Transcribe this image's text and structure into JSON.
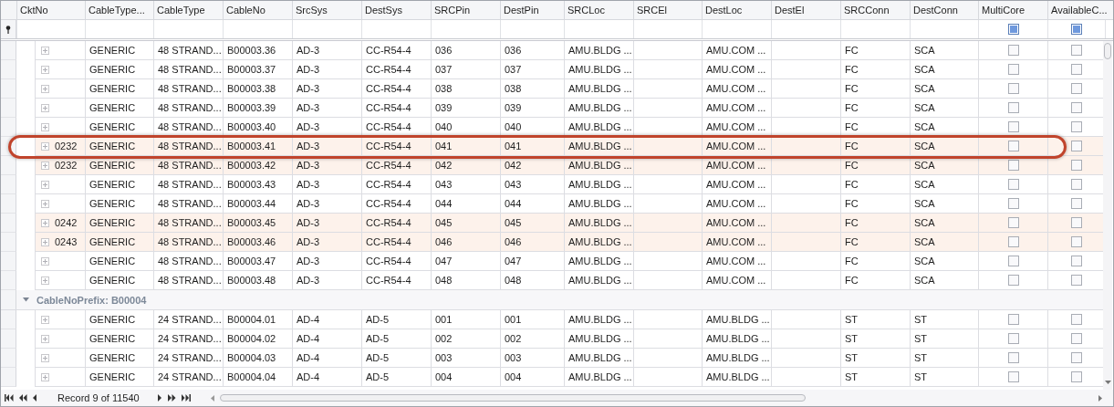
{
  "columns": [
    {
      "label": "CktNo",
      "kind": "text"
    },
    {
      "label": "CableType...",
      "kind": "text"
    },
    {
      "label": "CableType",
      "kind": "text"
    },
    {
      "label": "CableNo",
      "kind": "text"
    },
    {
      "label": "SrcSys",
      "kind": "text"
    },
    {
      "label": "DestSys",
      "kind": "text"
    },
    {
      "label": "SRCPin",
      "kind": "text"
    },
    {
      "label": "DestPin",
      "kind": "text"
    },
    {
      "label": "SRCLoc",
      "kind": "text"
    },
    {
      "label": "SRCEl",
      "kind": "text"
    },
    {
      "label": "DestLoc",
      "kind": "text"
    },
    {
      "label": "DestEl",
      "kind": "text"
    },
    {
      "label": "SRCConn",
      "kind": "text"
    },
    {
      "label": "DestConn",
      "kind": "text"
    },
    {
      "label": "MultiCore",
      "kind": "check",
      "filter_indeterminate": true
    },
    {
      "label": "AvailableC...",
      "kind": "check",
      "filter_indeterminate": true
    }
  ],
  "groups": [
    {
      "rows": [
        {
          "highlighted": false,
          "cells": [
            null,
            "GENERIC",
            "48 STRAND...",
            "B00003.36",
            "AD-3",
            "CC-R54-4",
            "036",
            "036",
            "AMU.BLDG ...",
            null,
            "AMU.COM ...",
            null,
            "FC",
            "SCA",
            false,
            false
          ]
        },
        {
          "highlighted": false,
          "cells": [
            null,
            "GENERIC",
            "48 STRAND...",
            "B00003.37",
            "AD-3",
            "CC-R54-4",
            "037",
            "037",
            "AMU.BLDG ...",
            null,
            "AMU.COM ...",
            null,
            "FC",
            "SCA",
            false,
            false
          ]
        },
        {
          "highlighted": false,
          "cells": [
            null,
            "GENERIC",
            "48 STRAND...",
            "B00003.38",
            "AD-3",
            "CC-R54-4",
            "038",
            "038",
            "AMU.BLDG ...",
            null,
            "AMU.COM ...",
            null,
            "FC",
            "SCA",
            false,
            false
          ]
        },
        {
          "highlighted": false,
          "cells": [
            null,
            "GENERIC",
            "48 STRAND...",
            "B00003.39",
            "AD-3",
            "CC-R54-4",
            "039",
            "039",
            "AMU.BLDG ...",
            null,
            "AMU.COM ...",
            null,
            "FC",
            "SCA",
            false,
            false
          ]
        },
        {
          "highlighted": false,
          "cells": [
            null,
            "GENERIC",
            "48 STRAND...",
            "B00003.40",
            "AD-3",
            "CC-R54-4",
            "040",
            "040",
            "AMU.BLDG ...",
            null,
            "AMU.COM ...",
            null,
            "FC",
            "SCA",
            false,
            false
          ]
        },
        {
          "highlighted": true,
          "cells": [
            "0232",
            "GENERIC",
            "48 STRAND...",
            "B00003.41",
            "AD-3",
            "CC-R54-4",
            "041",
            "041",
            "AMU.BLDG ...",
            null,
            "AMU.COM ...",
            null,
            "FC",
            "SCA",
            false,
            false
          ]
        },
        {
          "highlighted": true,
          "cells": [
            "0232",
            "GENERIC",
            "48 STRAND...",
            "B00003.42",
            "AD-3",
            "CC-R54-4",
            "042",
            "042",
            "AMU.BLDG ...",
            null,
            "AMU.COM ...",
            null,
            "FC",
            "SCA",
            false,
            false
          ]
        },
        {
          "highlighted": false,
          "cells": [
            null,
            "GENERIC",
            "48 STRAND...",
            "B00003.43",
            "AD-3",
            "CC-R54-4",
            "043",
            "043",
            "AMU.BLDG ...",
            null,
            "AMU.COM ...",
            null,
            "FC",
            "SCA",
            false,
            false
          ]
        },
        {
          "highlighted": false,
          "cells": [
            null,
            "GENERIC",
            "48 STRAND...",
            "B00003.44",
            "AD-3",
            "CC-R54-4",
            "044",
            "044",
            "AMU.BLDG ...",
            null,
            "AMU.COM ...",
            null,
            "FC",
            "SCA",
            false,
            false
          ]
        },
        {
          "highlighted": true,
          "cells": [
            "0242",
            "GENERIC",
            "48 STRAND...",
            "B00003.45",
            "AD-3",
            "CC-R54-4",
            "045",
            "045",
            "AMU.BLDG ...",
            null,
            "AMU.COM ...",
            null,
            "FC",
            "SCA",
            false,
            false
          ]
        },
        {
          "highlighted": true,
          "cells": [
            "0243",
            "GENERIC",
            "48 STRAND...",
            "B00003.46",
            "AD-3",
            "CC-R54-4",
            "046",
            "046",
            "AMU.BLDG ...",
            null,
            "AMU.COM ...",
            null,
            "FC",
            "SCA",
            false,
            false
          ]
        },
        {
          "highlighted": false,
          "cells": [
            null,
            "GENERIC",
            "48 STRAND...",
            "B00003.47",
            "AD-3",
            "CC-R54-4",
            "047",
            "047",
            "AMU.BLDG ...",
            null,
            "AMU.COM ...",
            null,
            "FC",
            "SCA",
            false,
            false
          ]
        },
        {
          "highlighted": false,
          "cells": [
            null,
            "GENERIC",
            "48 STRAND...",
            "B00003.48",
            "AD-3",
            "CC-R54-4",
            "048",
            "048",
            "AMU.BLDG ...",
            null,
            "AMU.COM ...",
            null,
            "FC",
            "SCA",
            false,
            false
          ]
        }
      ]
    },
    {
      "label": "CableNoPrefix: B00004",
      "expanded": true,
      "rows": [
        {
          "highlighted": false,
          "cells": [
            null,
            "GENERIC",
            "24 STRAND...",
            "B00004.01",
            "AD-4",
            "AD-5",
            "001",
            "001",
            "AMU.BLDG ...",
            null,
            "AMU.BLDG ...",
            null,
            "ST",
            "ST",
            false,
            false
          ]
        },
        {
          "highlighted": false,
          "cells": [
            null,
            "GENERIC",
            "24 STRAND...",
            "B00004.02",
            "AD-4",
            "AD-5",
            "002",
            "002",
            "AMU.BLDG ...",
            null,
            "AMU.BLDG ...",
            null,
            "ST",
            "ST",
            false,
            false
          ]
        },
        {
          "highlighted": false,
          "cells": [
            null,
            "GENERIC",
            "24 STRAND...",
            "B00004.03",
            "AD-4",
            "AD-5",
            "003",
            "003",
            "AMU.BLDG ...",
            null,
            "AMU.BLDG ...",
            null,
            "ST",
            "ST",
            false,
            false
          ]
        },
        {
          "highlighted": false,
          "cells": [
            null,
            "GENERIC",
            "24 STRAND...",
            "B00004.04",
            "AD-4",
            "AD-5",
            "004",
            "004",
            "AMU.BLDG ...",
            null,
            "AMU.BLDG ...",
            null,
            "ST",
            "ST",
            false,
            false
          ]
        }
      ]
    }
  ],
  "navigator": {
    "record_text": "Record 9 of 11540"
  }
}
